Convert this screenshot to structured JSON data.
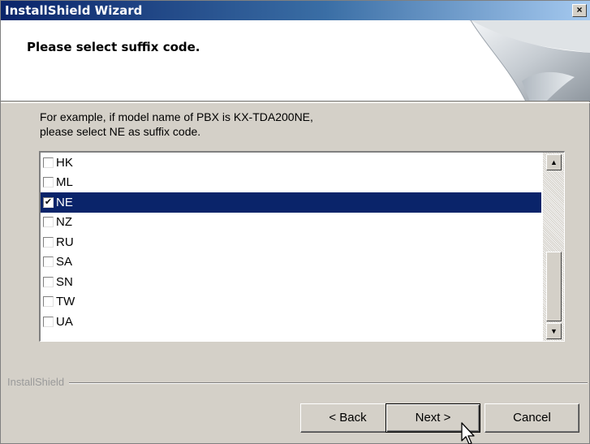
{
  "window": {
    "title": "InstallShield Wizard",
    "close_label": "×"
  },
  "header": {
    "heading": "Please select suffix code."
  },
  "description": {
    "line1": "For example, if model name of PBX is KX-TDA200NE,",
    "line2": "please select NE as suffix code."
  },
  "list": {
    "items": [
      {
        "label": "HK",
        "checked": false,
        "selected": false
      },
      {
        "label": "ML",
        "checked": false,
        "selected": false
      },
      {
        "label": "NE",
        "checked": true,
        "selected": true
      },
      {
        "label": "NZ",
        "checked": false,
        "selected": false
      },
      {
        "label": "RU",
        "checked": false,
        "selected": false
      },
      {
        "label": "SA",
        "checked": false,
        "selected": false
      },
      {
        "label": "SN",
        "checked": false,
        "selected": false
      },
      {
        "label": "TW",
        "checked": false,
        "selected": false
      },
      {
        "label": "UA",
        "checked": false,
        "selected": false
      }
    ]
  },
  "footer": {
    "brand": "InstallShield"
  },
  "buttons": {
    "back": "< Back",
    "next": "Next >",
    "cancel": "Cancel"
  },
  "colors": {
    "selection": "#0a246a",
    "title_start": "#0a246a",
    "title_end": "#a6caf0",
    "face": "#d4d0c8"
  },
  "icons": {
    "close": "close-icon",
    "scroll_up": "scroll-up-arrow-icon",
    "scroll_down": "scroll-down-arrow-icon",
    "check": "checkmark-icon",
    "cursor": "mouse-pointer-icon"
  }
}
